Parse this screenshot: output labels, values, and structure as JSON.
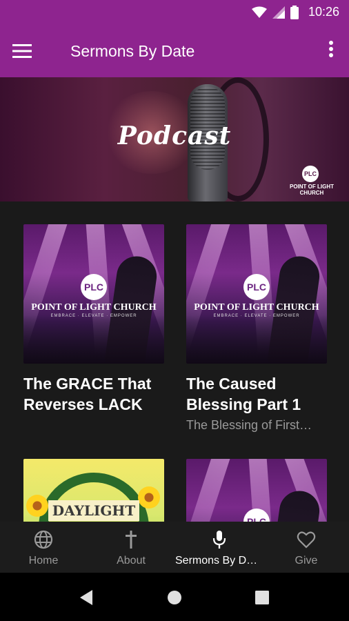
{
  "status_bar": {
    "time": "10:26"
  },
  "app_bar": {
    "title": "Sermons By Date",
    "menu_icon": "hamburger-menu-icon",
    "overflow_icon": "more-vert-icon"
  },
  "hero": {
    "title": "Podcast",
    "logo_circle": "PLC",
    "logo_text": "POINT OF LIGHT CHURCH"
  },
  "cards": [
    {
      "title": "The GRACE That Reverses LACK",
      "subtitle": "",
      "logo_circle": "PLC",
      "logo_name": "POINT OF LIGHT CHURCH",
      "logo_tag": "EMBRACE · ELEVATE · EMPOWER"
    },
    {
      "title": "The Caused Blessing Part 1",
      "subtitle": "The Blessing of First…",
      "logo_circle": "PLC",
      "logo_name": "POINT OF LIGHT CHURCH",
      "logo_tag": "EMBRACE · ELEVATE · EMPOWER"
    },
    {
      "sign": "DAYLIGHT"
    },
    {
      "logo_circle": "PLC"
    }
  ],
  "bottom_nav": [
    {
      "label": "Home",
      "icon": "globe-icon"
    },
    {
      "label": "About",
      "icon": "cross-icon"
    },
    {
      "label": "Sermons By Da…",
      "icon": "microphone-icon",
      "active": true
    },
    {
      "label": "Give",
      "icon": "heart-icon"
    }
  ],
  "colors": {
    "primary": "#8e248f",
    "background": "#1a1a1a",
    "nav_background": "#1c1c1c",
    "muted_text": "#9a9a9a"
  }
}
